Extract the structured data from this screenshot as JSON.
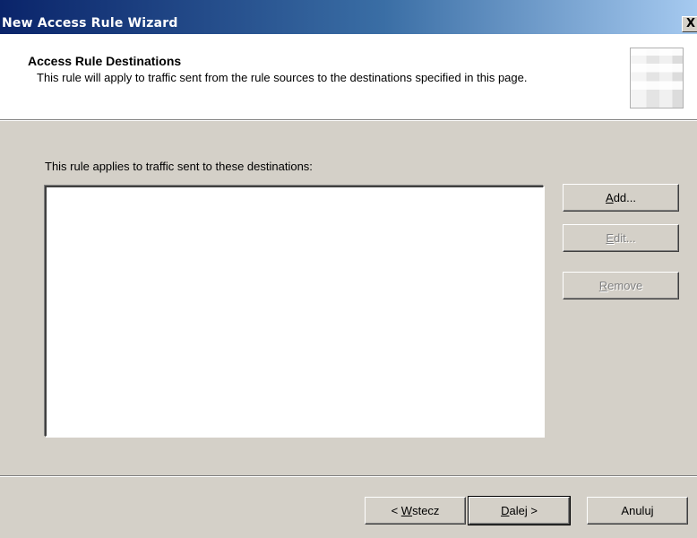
{
  "window": {
    "title": "New Access Rule Wizard",
    "close_label": "X"
  },
  "header": {
    "title": "Access Rule Destinations",
    "description": "This rule will apply to traffic sent from the rule sources to the destinations specified in this page."
  },
  "main": {
    "list_label": "This rule applies to traffic sent to these destinations:",
    "destinations": []
  },
  "side_buttons": {
    "add": {
      "accel": "A",
      "rest": "dd...",
      "enabled": true
    },
    "edit": {
      "accel": "E",
      "rest": "dit...",
      "enabled": false
    },
    "remove": {
      "accel": "R",
      "rest": "emove",
      "enabled": false
    }
  },
  "footer": {
    "back": {
      "prefix": "< ",
      "accel": "W",
      "rest": "stecz"
    },
    "next": {
      "accel": "D",
      "rest": "alej >"
    },
    "cancel": {
      "label": "Anuluj"
    }
  }
}
